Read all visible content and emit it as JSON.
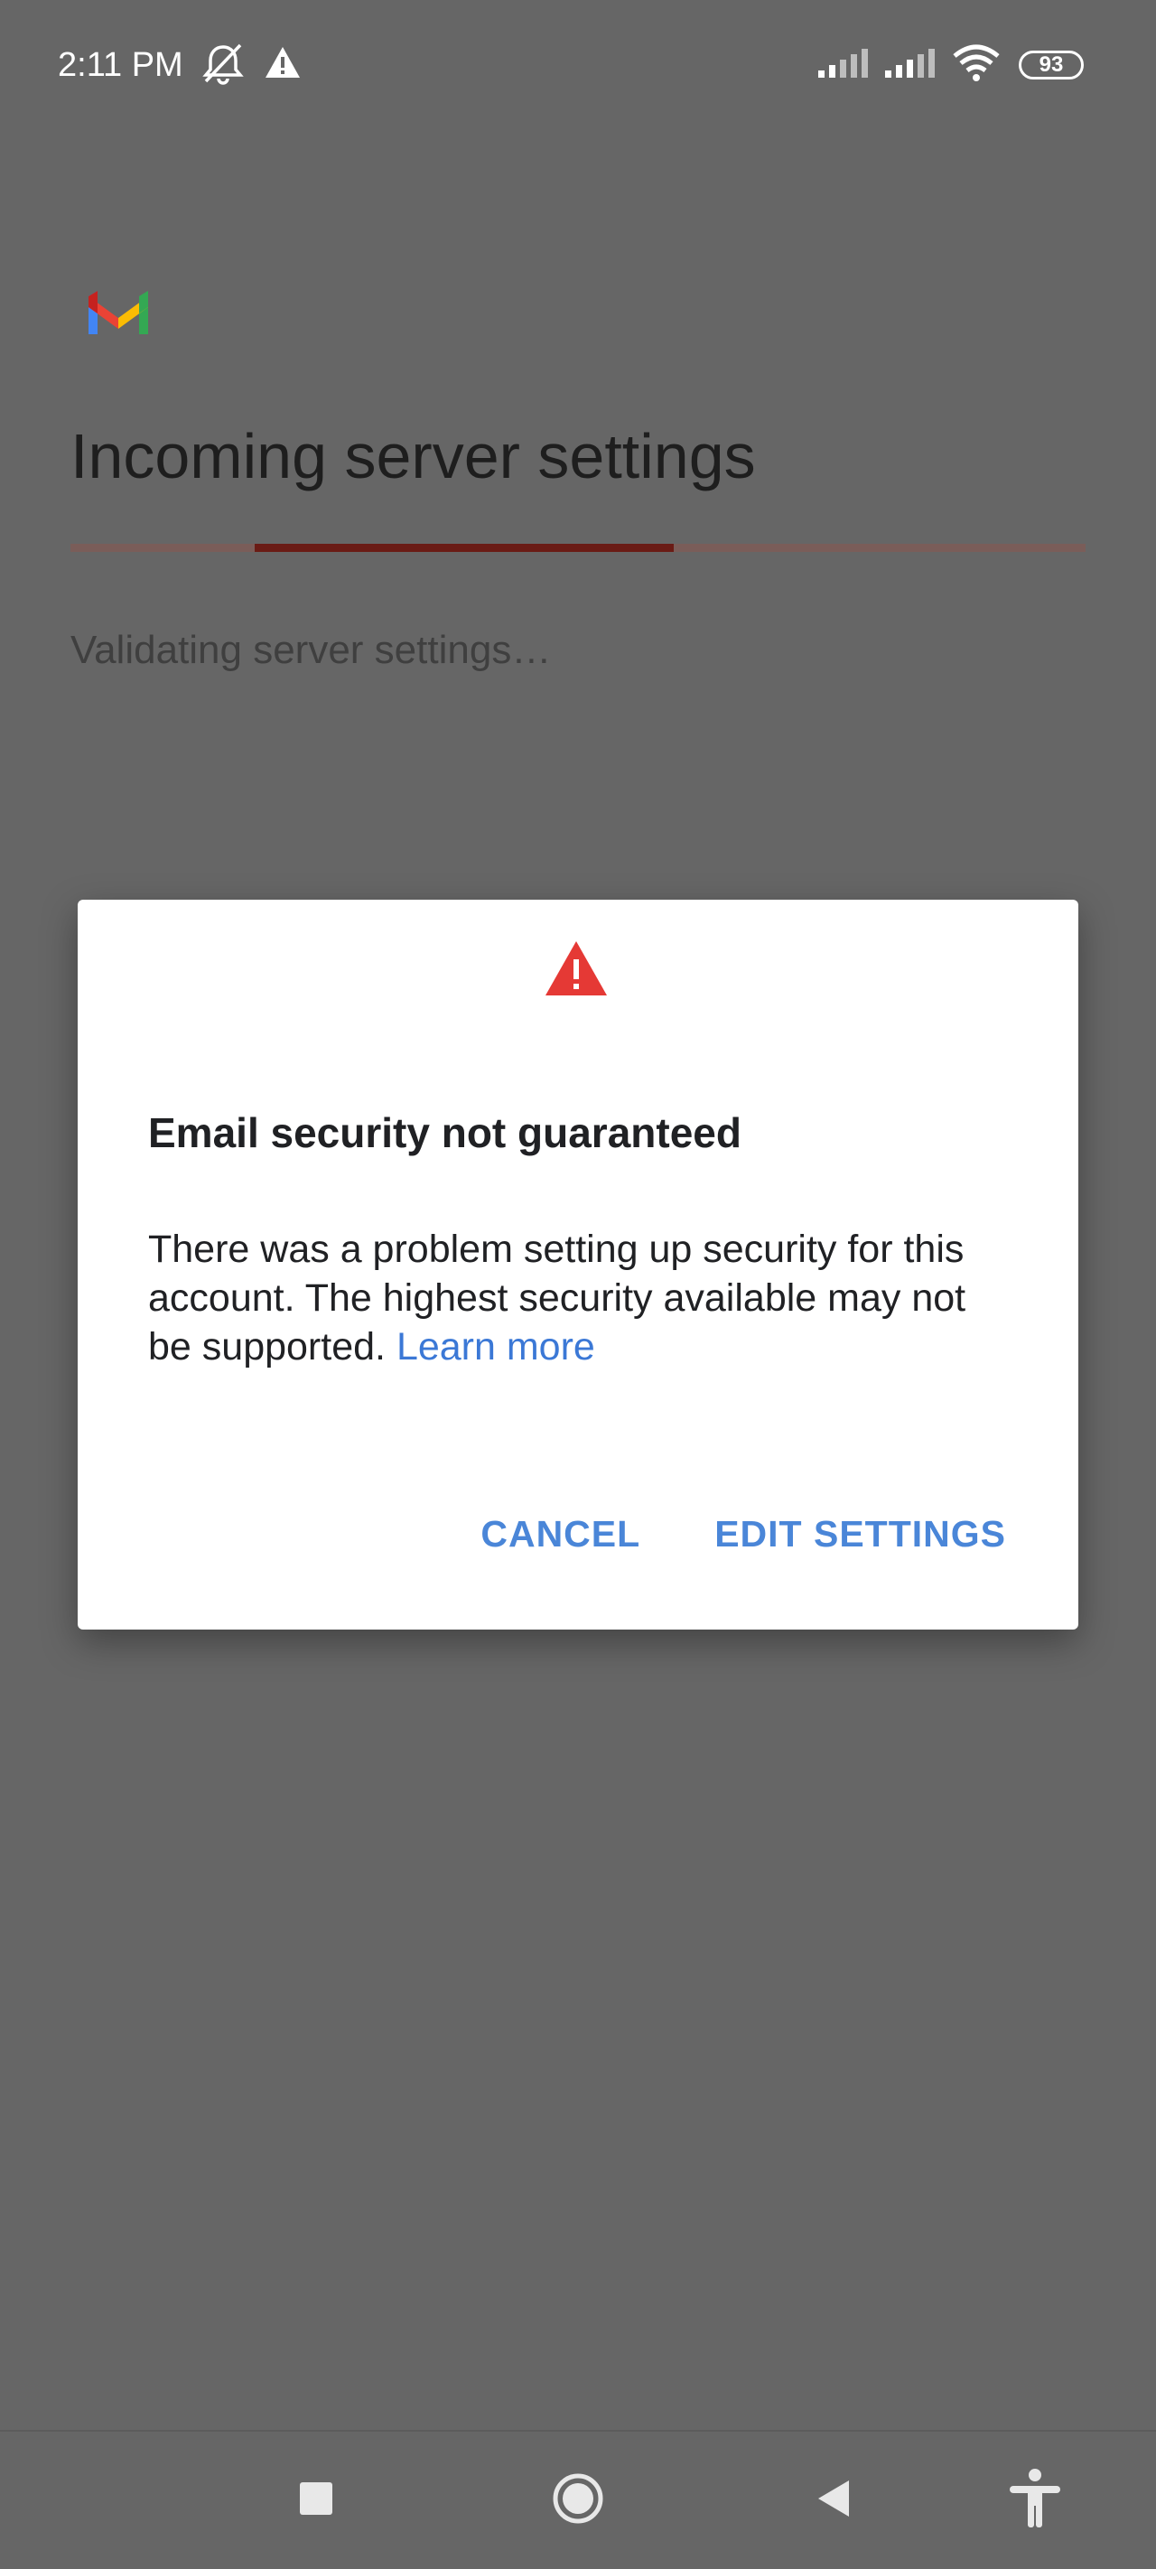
{
  "status_bar": {
    "time": "2:11 PM",
    "battery": "93",
    "icons": [
      "muted-notification-icon",
      "warning-icon",
      "signal-icon",
      "signal-icon",
      "wifi-icon",
      "battery-icon"
    ]
  },
  "page": {
    "logo": "gmail-logo",
    "title": "Incoming server settings",
    "status": "Validating server settings…",
    "progress_color": "#6a1b15"
  },
  "dialog": {
    "icon": "warning-icon",
    "icon_color": "#e53935",
    "title": "Email security not guaranteed",
    "body": "There was a problem setting up security for this account. The highest security available may not be supported.",
    "link": "Learn more",
    "link_color": "#3b78d6",
    "cancel_label": "CANCEL",
    "edit_label": "EDIT SETTINGS"
  },
  "nav_bar": {
    "icons": [
      "recents-icon",
      "home-icon",
      "back-icon",
      "accessibility-icon"
    ]
  }
}
